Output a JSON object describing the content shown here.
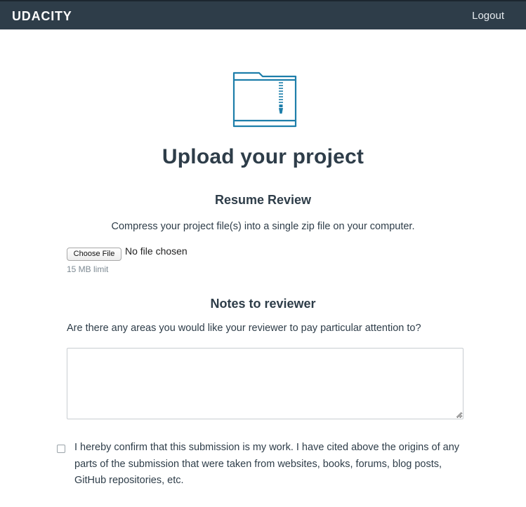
{
  "header": {
    "brand": "UDACITY",
    "logout_label": "Logout"
  },
  "icons": {
    "folder": "zipped-folder-icon",
    "resize": "resize-grip-icon"
  },
  "colors": {
    "header_bg": "#2e3d49",
    "accent_teal": "#1d7eaa",
    "text_primary": "#2e3d49"
  },
  "main": {
    "title": "Upload your project",
    "resume_heading": "Resume Review",
    "instruction": "Compress your project file(s) into a single zip file on your computer.",
    "file_input": {
      "button_label": "Choose File",
      "status": "No file chosen",
      "limit": "15 MB limit"
    },
    "notes": {
      "heading": "Notes to reviewer",
      "question": "Are there any areas you would like your reviewer to pay particular attention to?",
      "textarea_value": ""
    },
    "confirmation": {
      "checked": false,
      "text": "I hereby confirm that this submission is my work. I have cited above the origins of any parts of the submission that were taken from websites, books, forums, blog posts, GitHub repositories, etc."
    }
  }
}
